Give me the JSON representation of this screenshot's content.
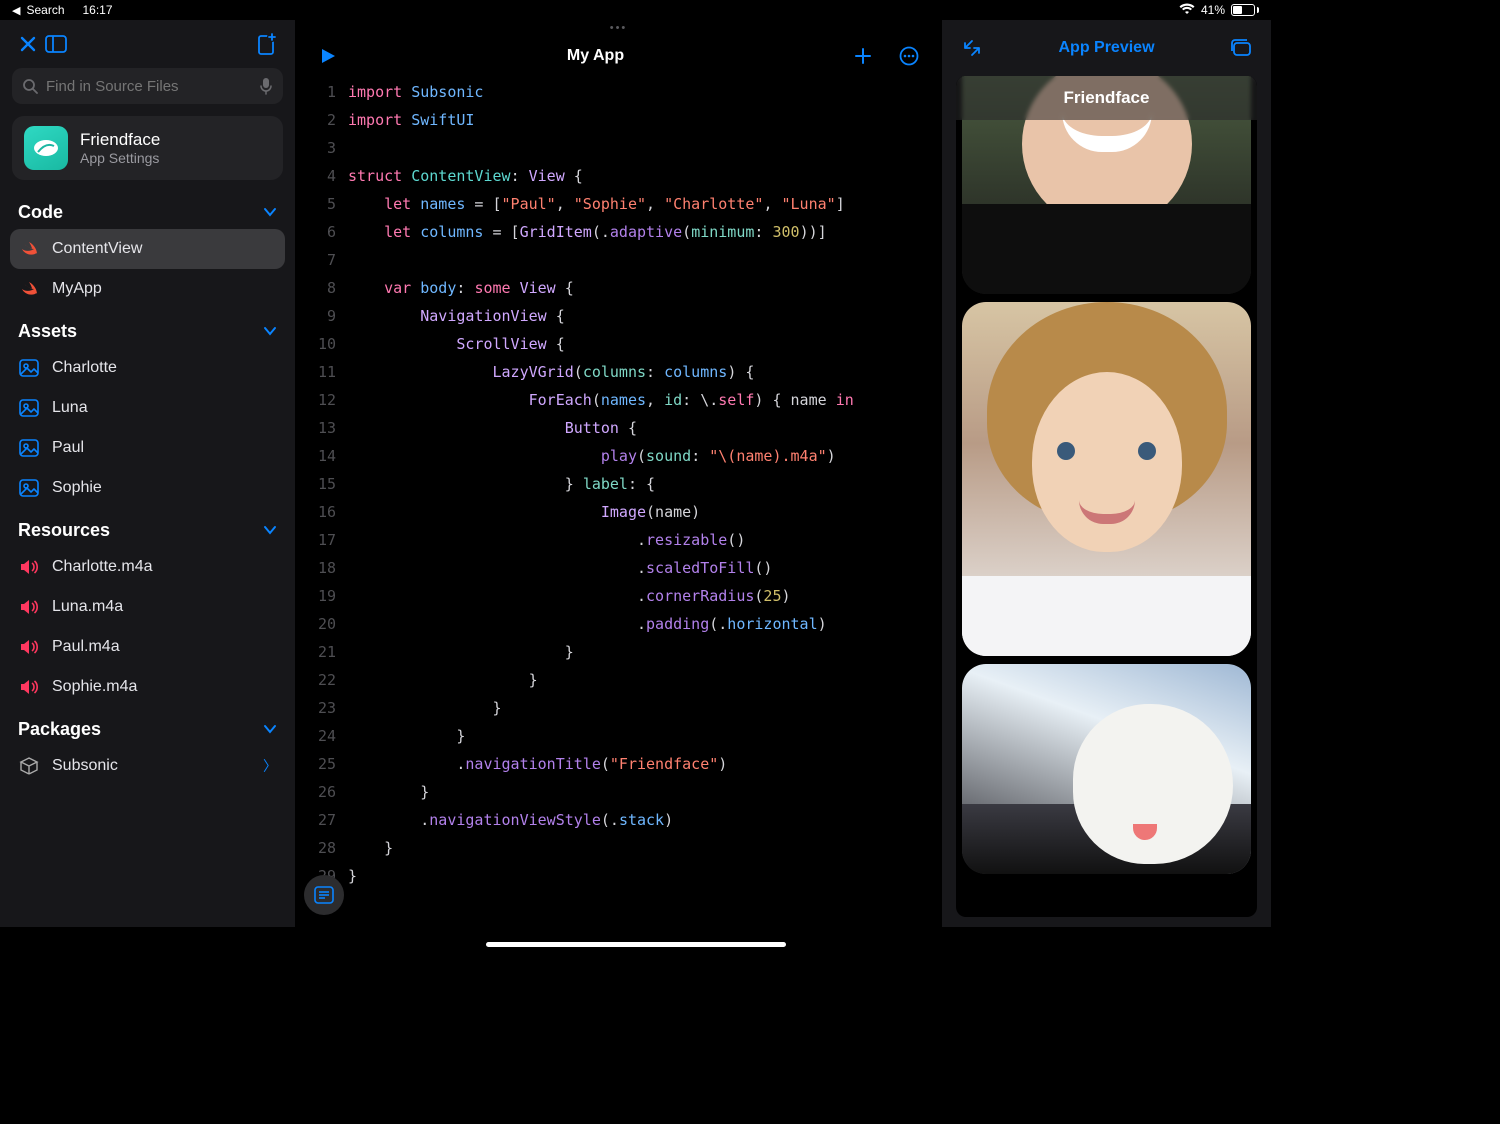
{
  "status": {
    "back": "Search",
    "time": "16:17",
    "battery": "41%"
  },
  "sidebar": {
    "search_placeholder": "Find in Source Files",
    "app": {
      "name": "Friendface",
      "subtitle": "App Settings"
    },
    "sections": {
      "code": {
        "title": "Code",
        "items": [
          "ContentView",
          "MyApp"
        ],
        "selected": 0
      },
      "assets": {
        "title": "Assets",
        "items": [
          "Charlotte",
          "Luna",
          "Paul",
          "Sophie"
        ]
      },
      "resources": {
        "title": "Resources",
        "items": [
          "Charlotte.m4a",
          "Luna.m4a",
          "Paul.m4a",
          "Sophie.m4a"
        ]
      },
      "packages": {
        "title": "Packages",
        "items": [
          "Subsonic"
        ]
      }
    }
  },
  "editor": {
    "title": "My App",
    "lines": [
      [
        [
          "kw-pink",
          "import"
        ],
        [
          "punct",
          " "
        ],
        [
          "id-blue",
          "Subsonic"
        ]
      ],
      [
        [
          "kw-pink",
          "import"
        ],
        [
          "punct",
          " "
        ],
        [
          "id-blue",
          "SwiftUI"
        ]
      ],
      [
        [
          "punct",
          ""
        ]
      ],
      [
        [
          "kw-pink",
          "struct"
        ],
        [
          "punct",
          " "
        ],
        [
          "type-teal",
          "ContentView"
        ],
        [
          "punct",
          ": "
        ],
        [
          "type-purple",
          "View"
        ],
        [
          "punct",
          " {"
        ]
      ],
      [
        [
          "punct",
          "    "
        ],
        [
          "kw-pink",
          "let"
        ],
        [
          "punct",
          " "
        ],
        [
          "id-blue",
          "names"
        ],
        [
          "punct",
          " = ["
        ],
        [
          "str",
          "\"Paul\""
        ],
        [
          "punct",
          ", "
        ],
        [
          "str",
          "\"Sophie\""
        ],
        [
          "punct",
          ", "
        ],
        [
          "str",
          "\"Charlotte\""
        ],
        [
          "punct",
          ", "
        ],
        [
          "str",
          "\"Luna\""
        ],
        [
          "punct",
          "]"
        ]
      ],
      [
        [
          "punct",
          "    "
        ],
        [
          "kw-pink",
          "let"
        ],
        [
          "punct",
          " "
        ],
        [
          "id-blue",
          "columns"
        ],
        [
          "punct",
          " = ["
        ],
        [
          "type-purple",
          "GridItem"
        ],
        [
          "punct",
          "(."
        ],
        [
          "fn-purple",
          "adaptive"
        ],
        [
          "punct",
          "("
        ],
        [
          "param-teal",
          "minimum"
        ],
        [
          "punct",
          ": "
        ],
        [
          "num",
          "300"
        ],
        [
          "punct",
          "))]"
        ]
      ],
      [
        [
          "punct",
          ""
        ]
      ],
      [
        [
          "punct",
          "    "
        ],
        [
          "kw-pink",
          "var"
        ],
        [
          "punct",
          " "
        ],
        [
          "id-blue",
          "body"
        ],
        [
          "punct",
          ": "
        ],
        [
          "kw-pink",
          "some"
        ],
        [
          "punct",
          " "
        ],
        [
          "type-purple",
          "View"
        ],
        [
          "punct",
          " {"
        ]
      ],
      [
        [
          "punct",
          "        "
        ],
        [
          "type-purple",
          "NavigationView"
        ],
        [
          "punct",
          " {"
        ]
      ],
      [
        [
          "punct",
          "            "
        ],
        [
          "type-purple",
          "ScrollView"
        ],
        [
          "punct",
          " {"
        ]
      ],
      [
        [
          "punct",
          "                "
        ],
        [
          "type-purple",
          "LazyVGrid"
        ],
        [
          "punct",
          "("
        ],
        [
          "param-teal",
          "columns"
        ],
        [
          "punct",
          ": "
        ],
        [
          "id-blue",
          "columns"
        ],
        [
          "punct",
          ") {"
        ]
      ],
      [
        [
          "punct",
          "                    "
        ],
        [
          "type-purple",
          "ForEach"
        ],
        [
          "punct",
          "("
        ],
        [
          "id-blue",
          "names"
        ],
        [
          "punct",
          ", "
        ],
        [
          "param-teal",
          "id"
        ],
        [
          "punct",
          ": \\."
        ],
        [
          "kw-pink",
          "self"
        ],
        [
          "punct",
          ") { name "
        ],
        [
          "kw-pink",
          "in"
        ]
      ],
      [
        [
          "punct",
          "                        "
        ],
        [
          "type-purple",
          "Button"
        ],
        [
          "punct",
          " {"
        ]
      ],
      [
        [
          "punct",
          "                            "
        ],
        [
          "fn-purple",
          "play"
        ],
        [
          "punct",
          "("
        ],
        [
          "param-teal",
          "sound"
        ],
        [
          "punct",
          ": "
        ],
        [
          "str",
          "\"\\(name).m4a\""
        ],
        [
          "punct",
          ")"
        ]
      ],
      [
        [
          "punct",
          "                        } "
        ],
        [
          "param-teal",
          "label"
        ],
        [
          "punct",
          ": {"
        ]
      ],
      [
        [
          "punct",
          "                            "
        ],
        [
          "type-purple",
          "Image"
        ],
        [
          "punct",
          "(name)"
        ]
      ],
      [
        [
          "punct",
          "                                ."
        ],
        [
          "fn-purple",
          "resizable"
        ],
        [
          "punct",
          "()"
        ]
      ],
      [
        [
          "punct",
          "                                ."
        ],
        [
          "fn-purple",
          "scaledToFill"
        ],
        [
          "punct",
          "()"
        ]
      ],
      [
        [
          "punct",
          "                                ."
        ],
        [
          "fn-purple",
          "cornerRadius"
        ],
        [
          "punct",
          "("
        ],
        [
          "num",
          "25"
        ],
        [
          "punct",
          ")"
        ]
      ],
      [
        [
          "punct",
          "                                ."
        ],
        [
          "fn-purple",
          "padding"
        ],
        [
          "punct",
          "(."
        ],
        [
          "id-blue",
          "horizontal"
        ],
        [
          "punct",
          ")"
        ]
      ],
      [
        [
          "punct",
          "                        }"
        ]
      ],
      [
        [
          "punct",
          "                    }"
        ]
      ],
      [
        [
          "punct",
          "                }"
        ]
      ],
      [
        [
          "punct",
          "            }"
        ]
      ],
      [
        [
          "punct",
          "            ."
        ],
        [
          "fn-purple",
          "navigationTitle"
        ],
        [
          "punct",
          "("
        ],
        [
          "str",
          "\"Friendface\""
        ],
        [
          "punct",
          ")"
        ]
      ],
      [
        [
          "punct",
          "        }"
        ]
      ],
      [
        [
          "punct",
          "        ."
        ],
        [
          "fn-purple",
          "navigationViewStyle"
        ],
        [
          "punct",
          "(."
        ],
        [
          "id-blue",
          "stack"
        ],
        [
          "punct",
          ")"
        ]
      ],
      [
        [
          "punct",
          "    }"
        ]
      ],
      [
        [
          "punct",
          "}"
        ]
      ]
    ]
  },
  "preview": {
    "toolbar_title": "App Preview",
    "nav_title": "Friendface"
  }
}
